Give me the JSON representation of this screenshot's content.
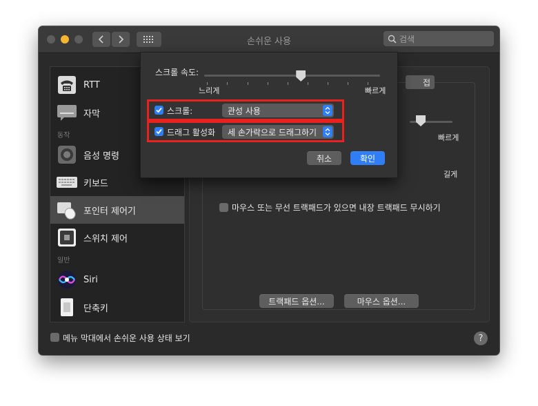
{
  "window": {
    "title": "손쉬운 사용"
  },
  "search": {
    "placeholder": "검색"
  },
  "sidebar": {
    "items": [
      {
        "label": "RTT",
        "icon": "tty-phone-icon"
      },
      {
        "label": "자막",
        "icon": "captions-icon"
      },
      {
        "label": "음성 명령",
        "icon": "voice-control-icon"
      },
      {
        "label": "키보드",
        "icon": "keyboard-icon"
      },
      {
        "label": "포인터 제어기",
        "icon": "pointer-control-icon",
        "selected": true
      },
      {
        "label": "스위치 제어",
        "icon": "switch-control-icon"
      },
      {
        "label": "Siri",
        "icon": "siri-icon"
      },
      {
        "label": "단축키",
        "icon": "shortcut-icon"
      }
    ],
    "sections": {
      "motor": "동작",
      "general": "일반"
    }
  },
  "pane": {
    "tab_fragment": "접",
    "speed_fast": "빠르게",
    "speed_long": "길게",
    "ignore_trackpad_label": "마우스 또는 무선 트랙패드가 있으면 내장 트랙패드 무시하기",
    "trackpad_options_button": "트랙패드 옵션...",
    "mouse_options_button": "마우스 옵션..."
  },
  "footer": {
    "show_status_label": "메뉴 막대에서 손쉬운 사용 상태 보기",
    "help": "?"
  },
  "sheet": {
    "scroll_speed_label": "스크롤 속도:",
    "slow_label": "느리게",
    "fast_label": "빠르게",
    "scroll_speed_value": 0.55,
    "scroll_checkbox_label": "스크롤:",
    "scroll_checked": true,
    "scroll_mode": "관성 사용",
    "drag_checkbox_label": "드래그 활성화",
    "drag_checked": true,
    "drag_mode": "세 손가락으로 드래그하기",
    "cancel_button": "취소",
    "ok_button": "확인"
  },
  "colors": {
    "accent": "#2f7ef6",
    "highlight": "#e8231f"
  }
}
